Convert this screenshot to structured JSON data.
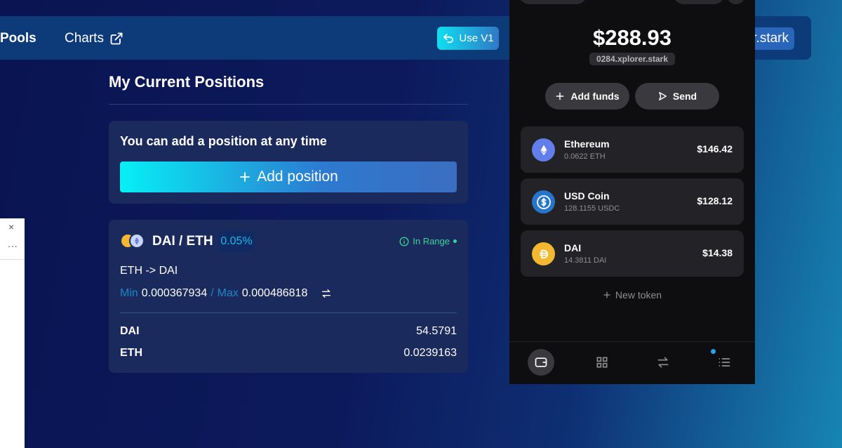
{
  "nav": {
    "pools_label": "Pools",
    "charts_label": "Charts",
    "use_v1_label": "Use V1",
    "account_label": "r.stark"
  },
  "main": {
    "title": "My Current Positions",
    "add_hint": "You can add a position at any time",
    "add_button_label": "Add position",
    "position": {
      "pair": "DAI / ETH",
      "fee": "0.05%",
      "status": "In Range",
      "direction": "ETH -> DAI",
      "min_label": "Min",
      "min_value": "0.000367934",
      "separator": "/",
      "max_label": "Max",
      "max_value": "0.000486818",
      "tokens": [
        {
          "symbol": "DAI",
          "amount": "54.5791"
        },
        {
          "symbol": "ETH",
          "amount": "0.0239163"
        }
      ]
    }
  },
  "sidebar": {
    "close_glyph": "×",
    "more_glyph": "..."
  },
  "wallet": {
    "balance": "$288.93",
    "account_name": "0284.xplorer.stark",
    "add_funds_label": "Add funds",
    "send_label": "Send",
    "tokens": [
      {
        "name": "Ethereum",
        "amount": "0.0622 ETH",
        "usd": "$146.42",
        "icon": "ethereum-icon",
        "color": "#627eea"
      },
      {
        "name": "USD Coin",
        "amount": "128.1155 USDC",
        "usd": "$128.12",
        "icon": "usdc-icon",
        "color": "#2775ca"
      },
      {
        "name": "DAI",
        "amount": "14.3811 DAI",
        "usd": "$14.38",
        "icon": "dai-icon",
        "color": "#f4b731"
      }
    ],
    "new_token_label": "New token",
    "bottom_nav": [
      "wallet-icon",
      "grid-icon",
      "swap-icon",
      "activity-icon"
    ]
  }
}
